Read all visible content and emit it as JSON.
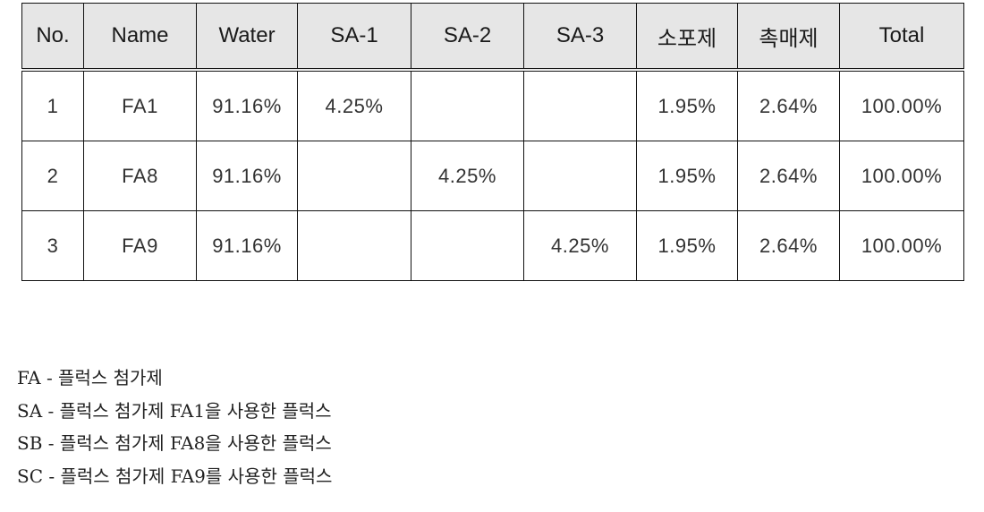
{
  "table": {
    "headers": [
      "No.",
      "Name",
      "Water",
      "SA-1",
      "SA-2",
      "SA-3",
      "소포제",
      "촉매제",
      "Total"
    ],
    "rows": [
      [
        "1",
        "FA1",
        "91.16%",
        "4.25%",
        "",
        "",
        "1.95%",
        "2.64%",
        "100.00%"
      ],
      [
        "2",
        "FA8",
        "91.16%",
        "",
        "4.25%",
        "",
        "1.95%",
        "2.64%",
        "100.00%"
      ],
      [
        "3",
        "FA9",
        "91.16%",
        "",
        "",
        "4.25%",
        "1.95%",
        "2.64%",
        "100.00%"
      ]
    ]
  },
  "notes": [
    "FA - 플럭스 첨가제",
    "SA - 플럭스 첨가제 FA1을 사용한 플럭스",
    "SB - 플럭스 첨가제 FA8을 사용한 플럭스",
    "SC - 플럭스 첨가제 FA9를 사용한 플럭스"
  ]
}
